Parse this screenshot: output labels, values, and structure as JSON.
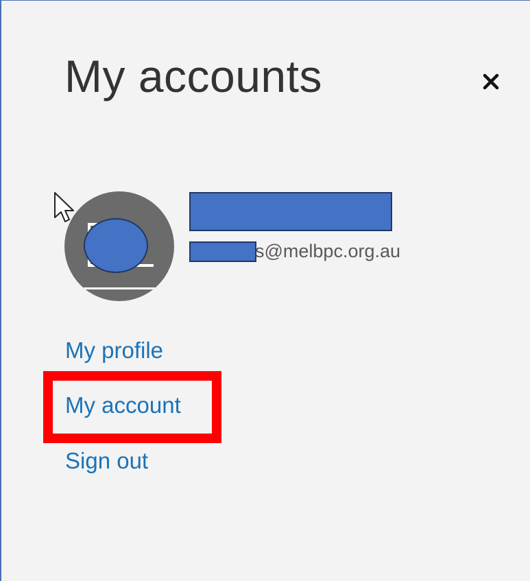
{
  "panel": {
    "title": "My accounts",
    "close_icon": "close-icon"
  },
  "account": {
    "avatar_icon": "user-avatar",
    "email_domain": "s@melbpc.org.au"
  },
  "links": {
    "profile": "My profile",
    "account": "My account",
    "sign_out": "Sign out"
  },
  "colors": {
    "background": "#f3f3f3",
    "title_text": "#333333",
    "link": "#1a73b8",
    "avatar": "#6b6b6b",
    "redaction": "#4472c4",
    "highlight": "#ff0000"
  }
}
